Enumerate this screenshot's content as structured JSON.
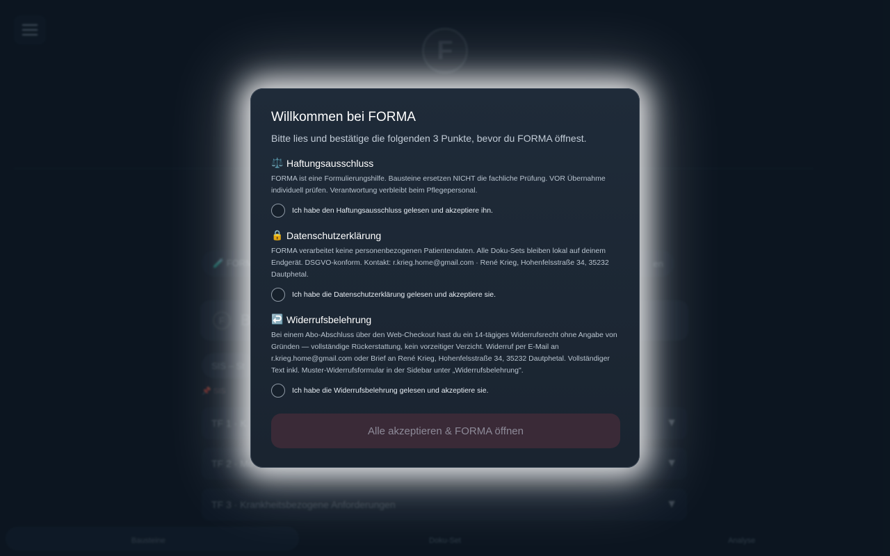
{
  "background": {
    "logo_letter": "F",
    "tabs": [
      "🧪 FORMA",
      "en"
    ],
    "search_logo_letter": "F",
    "search_placeholder": "B",
    "chip_label": "SIS – St",
    "chip_note": "📌 SIS",
    "sections": [
      {
        "label": "TF 1 · K",
        "chevron": "▼"
      },
      {
        "label": "TF 2 · Mo",
        "chevron": "▼"
      },
      {
        "label": "TF 3 · Krankheitsbezogene Anforderungen",
        "chevron": "▼"
      }
    ],
    "bottom_nav": [
      "Bausteine",
      "Doku-Set",
      "Analyse"
    ]
  },
  "modal": {
    "title": "Willkommen bei FORMA",
    "intro": "Bitte lies und bestätige die folgenden 3 Punkte, bevor du FORMA öffnest.",
    "sections": [
      {
        "icon": "⚖️",
        "title": "Haftungsausschluss",
        "text": "FORMA ist eine Formulierungshilfe. Bausteine ersetzen NICHT die fachliche Prüfung. VOR Übernahme individuell prüfen. Verantwortung verbleibt beim Pflegepersonal.",
        "check_label": "Ich habe den Haftungsausschluss gelesen und akzeptiere ihn."
      },
      {
        "icon": "🔒",
        "title": "Datenschutzerklärung",
        "text": "FORMA verarbeitet keine personenbezogenen Patientendaten. Alle Doku-Sets bleiben lokal auf deinem Endgerät. DSGVO-konform. Kontakt: r.krieg.home@gmail.com · René Krieg, Hohenfelsstraße 34, 35232 Dautphetal.",
        "check_label": "Ich habe die Datenschutzerklärung gelesen und akzeptiere sie."
      },
      {
        "icon": "↩️",
        "title": "Widerrufsbelehrung",
        "text": "Bei einem Abo-Abschluss über den Web-Checkout hast du ein 14-tägiges Widerrufsrecht ohne Angabe von Gründen — vollständige Rückerstattung, kein vorzeitiger Verzicht. Widerruf per E-Mail an r.krieg.home@gmail.com oder Brief an René Krieg, Hohenfelsstraße 34, 35232 Dautphetal. Vollständiger Text inkl. Muster-Widerrufsformular in der Sidebar unter „Widerrufsbelehrung\".",
        "check_label": "Ich habe die Widerrufsbelehrung gelesen und akzeptiere sie."
      }
    ],
    "accept_label": "Alle akzeptieren & FORMA öffnen"
  }
}
